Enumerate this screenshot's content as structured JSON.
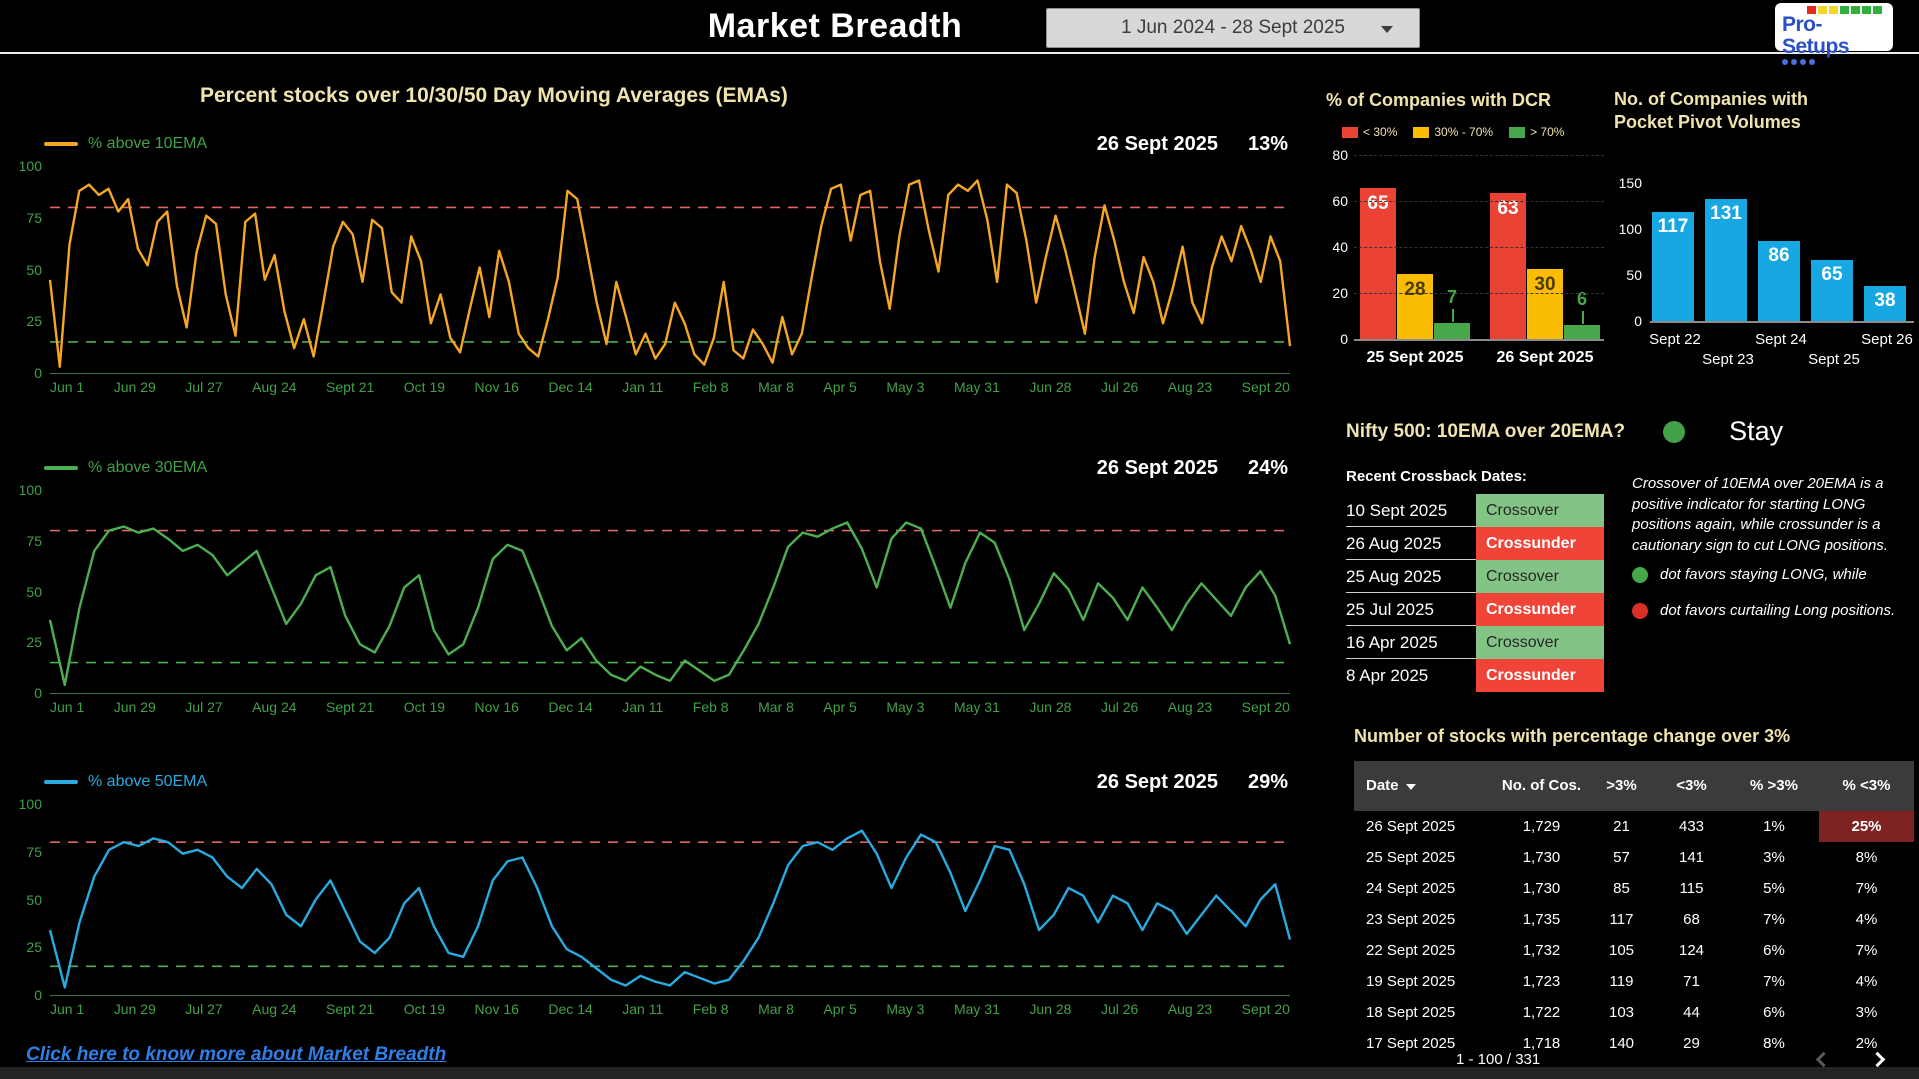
{
  "header": {
    "title": "Market Breadth",
    "date_range": "1 Jun 2024 - 28 Sept 2025",
    "logo": {
      "text": "Pro-Setups",
      "squares": [
        "#e8291c",
        "#f5d327",
        "#f5d327",
        "#2faf3c",
        "#2faf3c",
        "#2faf3c",
        "#2faf3c"
      ],
      "dot_color": "#4a71d8"
    }
  },
  "ema_section": {
    "title": "Percent stocks over 10/30/50 Day Moving Averages (EMAs)",
    "link": "Click here to know more about Market Breadth"
  },
  "chart_data": [
    {
      "type": "line",
      "title": "% above 10EMA",
      "color": "#f5a623",
      "legend_color": "#43a047",
      "label_date": "26 Sept 2025",
      "label_value": "13%",
      "ylim": [
        0,
        100
      ],
      "y_ticks": [
        100,
        75,
        50,
        25,
        0
      ],
      "x_ticks": [
        "Jun 1",
        "Jun 29",
        "Jul 27",
        "Aug 24",
        "Sept 21",
        "Oct 19",
        "Nov 16",
        "Dec 14",
        "Jan 11",
        "Feb 8",
        "Mar 8",
        "Apr 5",
        "May 3",
        "May 31",
        "Jun 28",
        "Jul 26",
        "Aug 23",
        "Sept 20"
      ],
      "thresholds": [
        {
          "value": 80,
          "color": "#e06666"
        },
        {
          "value": 15,
          "color": "#4caf50"
        }
      ],
      "values": [
        45,
        3,
        62,
        88,
        91,
        86,
        89,
        78,
        84,
        60,
        52,
        73,
        78,
        42,
        22,
        58,
        76,
        72,
        38,
        18,
        73,
        77,
        45,
        57,
        30,
        12,
        26,
        8,
        34,
        61,
        73,
        67,
        44,
        74,
        70,
        39,
        34,
        66,
        54,
        24,
        38,
        17,
        10,
        31,
        51,
        27,
        59,
        44,
        19,
        12,
        8,
        26,
        46,
        88,
        84,
        59,
        34,
        14,
        44,
        27,
        9,
        19,
        7,
        14,
        34,
        24,
        9,
        4,
        17,
        44,
        11,
        7,
        21,
        14,
        5,
        27,
        9,
        19,
        46,
        71,
        89,
        91,
        64,
        86,
        88,
        54,
        31,
        66,
        91,
        93,
        69,
        49,
        86,
        91,
        88,
        93,
        74,
        44,
        91,
        87,
        64,
        34,
        56,
        76,
        59,
        39,
        19,
        56,
        81,
        64,
        44,
        29,
        56,
        44,
        24,
        41,
        61,
        34,
        24,
        51,
        66,
        54,
        71,
        59,
        44,
        66,
        54,
        13
      ]
    },
    {
      "type": "line",
      "title": "% above 30EMA",
      "color": "#4caf50",
      "legend_color": "#43a047",
      "label_date": "26 Sept 2025",
      "label_value": "24%",
      "ylim": [
        0,
        100
      ],
      "y_ticks": [
        100,
        75,
        50,
        25,
        0
      ],
      "x_ticks": [
        "Jun 1",
        "Jun 29",
        "Jul 27",
        "Aug 24",
        "Sept 21",
        "Oct 19",
        "Nov 16",
        "Dec 14",
        "Jan 11",
        "Feb 8",
        "Mar 8",
        "Apr 5",
        "May 3",
        "May 31",
        "Jun 28",
        "Jul 26",
        "Aug 23",
        "Sept 20"
      ],
      "thresholds": [
        {
          "value": 80,
          "color": "#e06666"
        },
        {
          "value": 15,
          "color": "#4caf50"
        }
      ],
      "values": [
        36,
        4,
        42,
        70,
        80,
        82,
        79,
        81,
        76,
        70,
        73,
        68,
        58,
        64,
        70,
        52,
        34,
        44,
        58,
        62,
        38,
        24,
        20,
        33,
        52,
        58,
        31,
        19,
        24,
        42,
        66,
        73,
        70,
        52,
        33,
        21,
        27,
        16,
        9,
        6,
        13,
        9,
        6,
        16,
        11,
        6,
        9,
        21,
        34,
        52,
        72,
        79,
        77,
        81,
        84,
        71,
        52,
        76,
        84,
        81,
        62,
        42,
        64,
        79,
        74,
        56,
        31,
        44,
        59,
        51,
        36,
        54,
        47,
        36,
        52,
        42,
        31,
        44,
        54,
        46,
        38,
        52,
        60,
        48,
        24
      ]
    },
    {
      "type": "line",
      "title": "% above 50EMA",
      "color": "#29abe2",
      "legend_color": "#29abe2",
      "label_date": "26 Sept 2025",
      "label_value": "29%",
      "ylim": [
        0,
        100
      ],
      "y_ticks": [
        100,
        75,
        50,
        25,
        0
      ],
      "x_ticks": [
        "Jun 1",
        "Jun 29",
        "Jul 27",
        "Aug 24",
        "Sept 21",
        "Oct 19",
        "Nov 16",
        "Dec 14",
        "Jan 11",
        "Feb 8",
        "Mar 8",
        "Apr 5",
        "May 3",
        "May 31",
        "Jun 28",
        "Jul 26",
        "Aug 23",
        "Sept 20"
      ],
      "thresholds": [
        {
          "value": 80,
          "color": "#e06666"
        },
        {
          "value": 15,
          "color": "#4caf50"
        }
      ],
      "values": [
        34,
        4,
        38,
        62,
        76,
        80,
        78,
        82,
        80,
        74,
        76,
        72,
        62,
        56,
        66,
        58,
        42,
        36,
        50,
        60,
        44,
        28,
        22,
        30,
        48,
        56,
        36,
        22,
        20,
        36,
        60,
        70,
        72,
        56,
        36,
        24,
        20,
        14,
        8,
        5,
        10,
        7,
        5,
        12,
        9,
        6,
        8,
        18,
        30,
        48,
        68,
        78,
        80,
        76,
        82,
        86,
        74,
        56,
        72,
        84,
        80,
        64,
        44,
        60,
        78,
        76,
        58,
        34,
        42,
        56,
        52,
        38,
        52,
        48,
        34,
        48,
        44,
        32,
        42,
        52,
        44,
        36,
        50,
        58,
        29
      ]
    },
    {
      "type": "bar",
      "title": "% of Companies with DCR",
      "categories": [
        "25 Sept 2025",
        "26 Sept 2025"
      ],
      "series": [
        {
          "name": "< 30%",
          "color": "#ea4335",
          "values": [
            65,
            63
          ]
        },
        {
          "name": "30% - 70%",
          "color": "#fbbc04",
          "values": [
            28,
            30
          ]
        },
        {
          "name": "> 70%",
          "color": "#47a84b",
          "values": [
            7,
            6
          ]
        }
      ],
      "ylim": [
        0,
        80
      ],
      "y_ticks": [
        80,
        60,
        40,
        20,
        0
      ]
    },
    {
      "type": "bar",
      "title": "No. of Companies with Pocket Pivot Volumes",
      "categories": [
        "Sept 22",
        "Sept 23",
        "Sept 24",
        "Sept 25",
        "Sept 26"
      ],
      "values": [
        117,
        131,
        86,
        65,
        38
      ],
      "color": "#17a8e3",
      "ylim": [
        0,
        150
      ],
      "y_ticks": [
        150,
        100,
        50,
        0
      ]
    }
  ],
  "nifty": {
    "title": "Nifty 500: 10EMA over 20EMA?",
    "status": "Stay",
    "status_color": "#43a047",
    "crossback_title": "Recent Crossback Dates:",
    "crossback": [
      {
        "date": "10 Sept 2025",
        "status": "Crossover"
      },
      {
        "date": "26 Aug 2025",
        "status": "Crossunder"
      },
      {
        "date": "25 Aug 2025",
        "status": "Crossover"
      },
      {
        "date": "25 Jul 2025",
        "status": "Crossunder"
      },
      {
        "date": "16 Apr 2025",
        "status": "Crossover"
      },
      {
        "date": "8 Apr 2025",
        "status": "Crossunder"
      }
    ],
    "note": "Crossover of 10EMA over 20EMA is a positive indicator for starting LONG positions again, while crossunder is a cautionary sign to cut LONG positions.",
    "bullet_green": "dot favors staying LONG, while",
    "bullet_red": "dot favors curtailing Long positions."
  },
  "stocks_table": {
    "title": "Number of stocks with percentage change over 3%",
    "columns": [
      "Date",
      "No. of Cos.",
      ">3%",
      "<3%",
      "% >3%",
      "% <3%"
    ],
    "rows": [
      [
        "26 Sept 2025",
        "1,729",
        "21",
        "433",
        "1%",
        "25%"
      ],
      [
        "25 Sept 2025",
        "1,730",
        "57",
        "141",
        "3%",
        "8%"
      ],
      [
        "24 Sept 2025",
        "1,730",
        "85",
        "115",
        "5%",
        "7%"
      ],
      [
        "23 Sept 2025",
        "1,735",
        "117",
        "68",
        "7%",
        "4%"
      ],
      [
        "22 Sept 2025",
        "1,732",
        "105",
        "124",
        "6%",
        "7%"
      ],
      [
        "19 Sept 2025",
        "1,723",
        "119",
        "71",
        "7%",
        "4%"
      ],
      [
        "18 Sept 2025",
        "1,722",
        "103",
        "44",
        "6%",
        "3%"
      ],
      [
        "17 Sept 2025",
        "1,718",
        "140",
        "29",
        "8%",
        "2%"
      ]
    ],
    "highlight": {
      "row": 0,
      "col": 5,
      "color": "#7e2222"
    },
    "pagination": "1 - 100 / 331"
  }
}
